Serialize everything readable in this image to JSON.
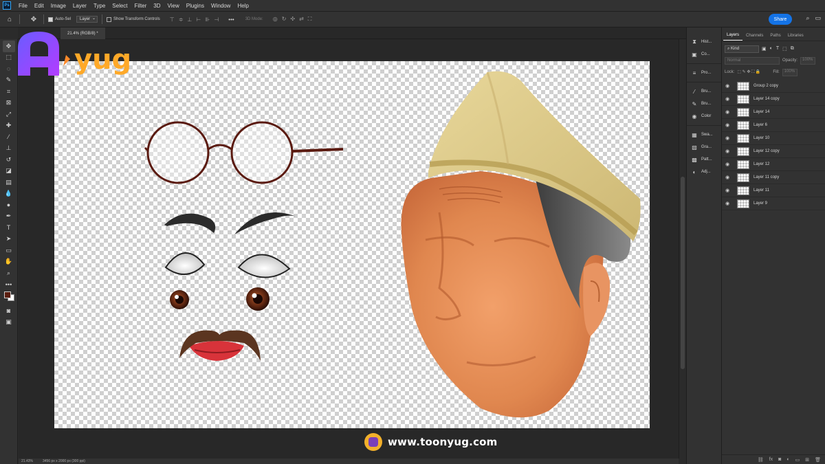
{
  "app": {
    "logo": "Ps"
  },
  "menu": [
    "File",
    "Edit",
    "Image",
    "Layer",
    "Type",
    "Select",
    "Filter",
    "3D",
    "View",
    "Plugins",
    "Window",
    "Help"
  ],
  "options": {
    "auto_select_label": "Auto-Sel",
    "auto_select_target": "Layer",
    "transform_label": "Show Transform Controls",
    "mode_3d_label": "3D Mode:",
    "share_label": "Share"
  },
  "document": {
    "tab_label": "21.4% (RGB/8) *"
  },
  "status": {
    "zoom": "21.43%",
    "info": "3456 px x 2000 px (300 ppi)"
  },
  "brand": {
    "logo_text": "yug",
    "url": "www.toonyug.com"
  },
  "panel_strip": {
    "group1": [
      {
        "icon": "history-icon",
        "label": "Hist..."
      },
      {
        "icon": "comments-icon",
        "label": "Co..."
      }
    ],
    "group2": [
      {
        "icon": "properties-icon",
        "label": "Pro..."
      }
    ],
    "group3": [
      {
        "icon": "brush-icon",
        "label": "Bru..."
      },
      {
        "icon": "brush-settings-icon",
        "label": "Bru..."
      },
      {
        "icon": "color-icon",
        "label": "Color"
      }
    ],
    "group4": [
      {
        "icon": "swatches-icon",
        "label": "Swa..."
      },
      {
        "icon": "gradients-icon",
        "label": "Gra..."
      },
      {
        "icon": "patterns-icon",
        "label": "Patt..."
      },
      {
        "icon": "adjustments-icon",
        "label": "Adj..."
      }
    ]
  },
  "layers_panel": {
    "tabs": [
      "Layers",
      "Channels",
      "Paths",
      "Libraries"
    ],
    "active_tab": "Layers",
    "kind_label": "Kind",
    "blend_mode": "Normal",
    "opacity_label": "Opacity:",
    "opacity_value": "100%",
    "lock_label": "Lock:",
    "fill_label": "Fill:",
    "fill_value": "100%",
    "layers": [
      "Group 2 copy",
      "Layer 14 copy",
      "Layer 14",
      "Layer 6",
      "Layer 10",
      "Layer 12 copy",
      "Layer 12",
      "Layer 11 copy",
      "Layer 11",
      "Layer 9"
    ]
  },
  "colors": {
    "accent": "#1473e6",
    "foreground_swatch": "#5a1e10",
    "background_swatch": "#ffffff",
    "skin": "#e0874f",
    "cap": "#dcc987",
    "lips": "#d8333a"
  }
}
